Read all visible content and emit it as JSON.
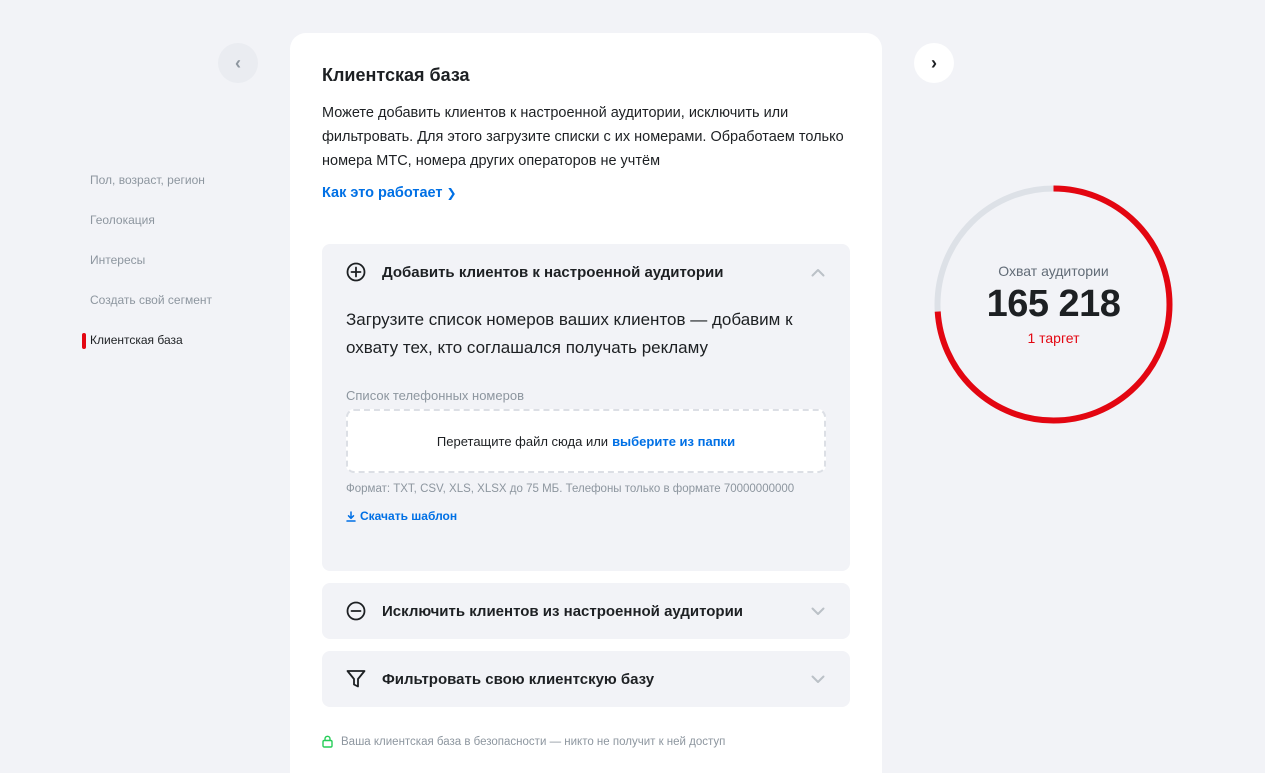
{
  "nav": {
    "prev_icon": "‹",
    "next_icon": "›"
  },
  "sidebar": {
    "items": [
      {
        "label": "Пол, возраст, регион",
        "active": false
      },
      {
        "label": "Геолокация",
        "active": false
      },
      {
        "label": "Интересы",
        "active": false
      },
      {
        "label": "Создать свой сегмент",
        "active": false
      },
      {
        "label": "Клиентская база",
        "active": true
      }
    ]
  },
  "card": {
    "title": "Клиентская база",
    "description": "Можете добавить клиентов к настроенной аудитории, исключить или фильтровать. Для этого загрузите списки с их номерами. Обработаем только номера МТС, номера других операторов не учтём",
    "how_link": "Как это работает",
    "panels": {
      "add": {
        "title": "Добавить клиентов к настроенной аудитории",
        "icon": "plus-circle-icon",
        "lead": "Загрузите список номеров ваших клиентов — добавим к охвату тех, кто соглашался получать рекламу",
        "field_label": "Список телефонных номеров",
        "drop_text": "Перетащите файл сюда или",
        "drop_link": "выберите из папки",
        "format_note": "Формат: TXT, CSV, XLS, XLSX до 75 МБ. Телефоны только в формате 70000000000",
        "download_link": "Скачать шаблон"
      },
      "exclude": {
        "title": "Исключить клиентов из настроенной аудитории",
        "icon": "minus-circle-icon"
      },
      "filter": {
        "title": "Фильтровать свою клиентскую базу",
        "icon": "funnel-icon"
      }
    },
    "security_note": "Ваша клиентская база в безопасности — никто не получит к ней доступ"
  },
  "reach": {
    "label": "Охват аудитории",
    "value": "165 218",
    "target": "1 таргет",
    "progress": 0.74,
    "colors": {
      "fill": "#e30611",
      "track": "#dde1e7"
    }
  }
}
